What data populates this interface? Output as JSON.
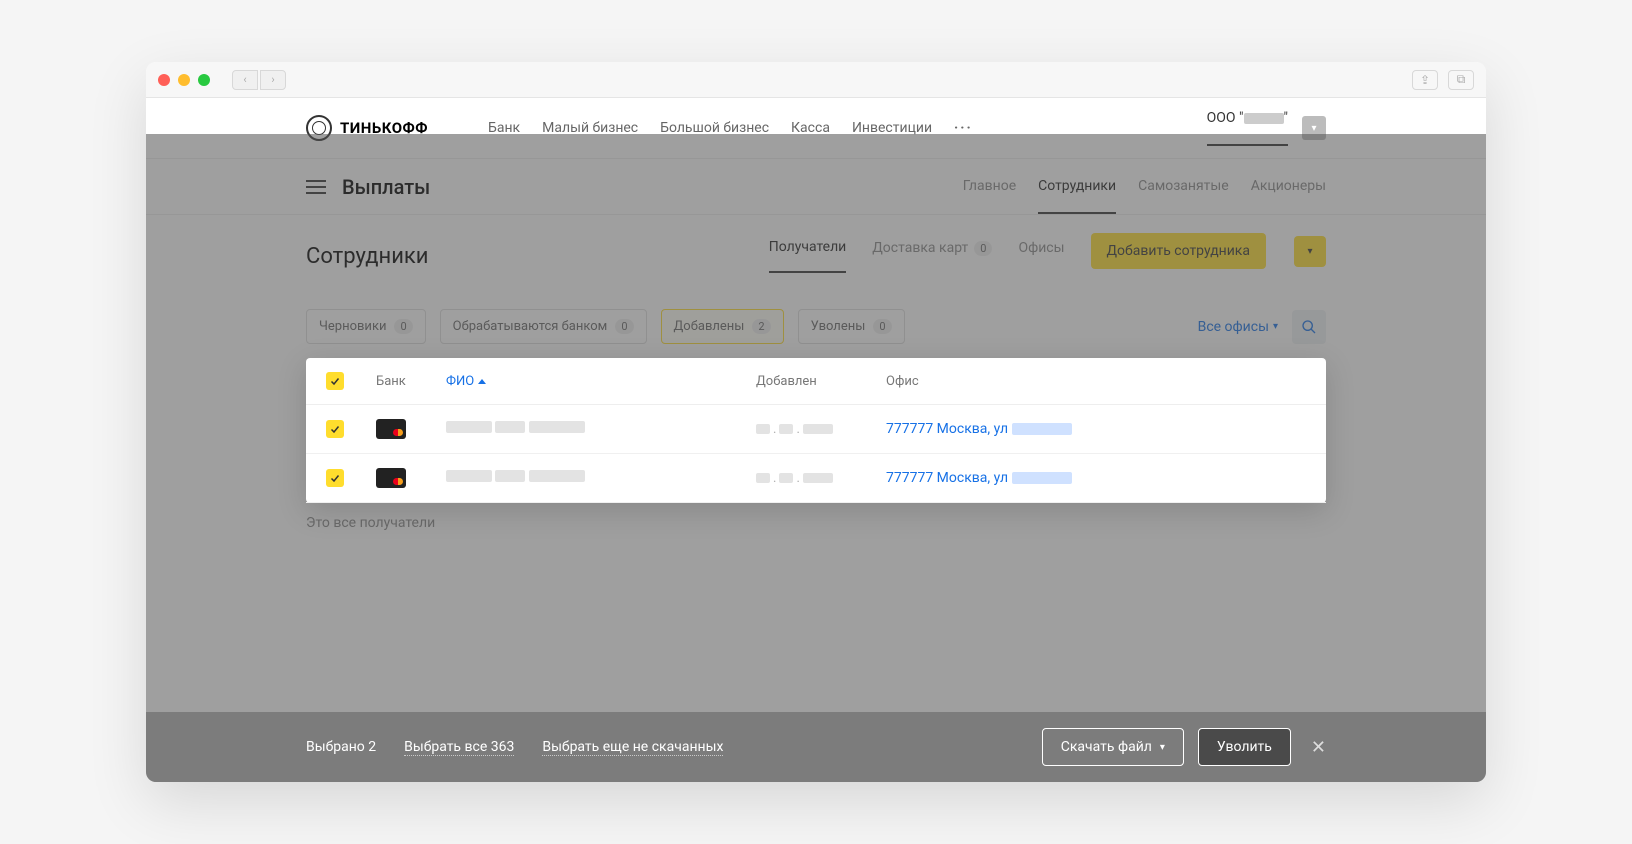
{
  "brand": "ТИНЬКОФФ",
  "topnav": [
    "Банк",
    "Малый бизнес",
    "Большой бизнес",
    "Касса",
    "Инвестиции"
  ],
  "account_prefix": "ООО \"",
  "account_suffix": "\"",
  "page_title": "Выплаты",
  "subnav": {
    "main": "Главное",
    "employees": "Сотрудники",
    "self": "Самозанятые",
    "share": "Акционеры"
  },
  "section_title": "Сотрудники",
  "tabs3": {
    "recipients": "Получатели",
    "delivery": "Доставка карт",
    "delivery_badge": "0",
    "offices": "Офисы"
  },
  "add_btn": "Добавить сотрудника",
  "filters": [
    {
      "label": "Черновики",
      "badge": "0"
    },
    {
      "label": "Обрабатываются банком",
      "badge": "0"
    },
    {
      "label": "Добавлены",
      "badge": "2",
      "active": true
    },
    {
      "label": "Уволены",
      "badge": "0"
    }
  ],
  "offices_filter": "Все офисы",
  "thead": {
    "bank": "Банк",
    "fio": "ФИО",
    "added": "Добавлен",
    "office": "Офис"
  },
  "rows": [
    {
      "office": "777777 Москва, ул"
    },
    {
      "office": "777777 Москва, ул"
    }
  ],
  "all_msg": "Это все получатели",
  "actionbar": {
    "selected": "Выбрано 2",
    "select_all": "Выбрать все 363",
    "select_rest": "Выбрать еще не скачанных",
    "download": "Скачать файл",
    "fire": "Уволить"
  }
}
